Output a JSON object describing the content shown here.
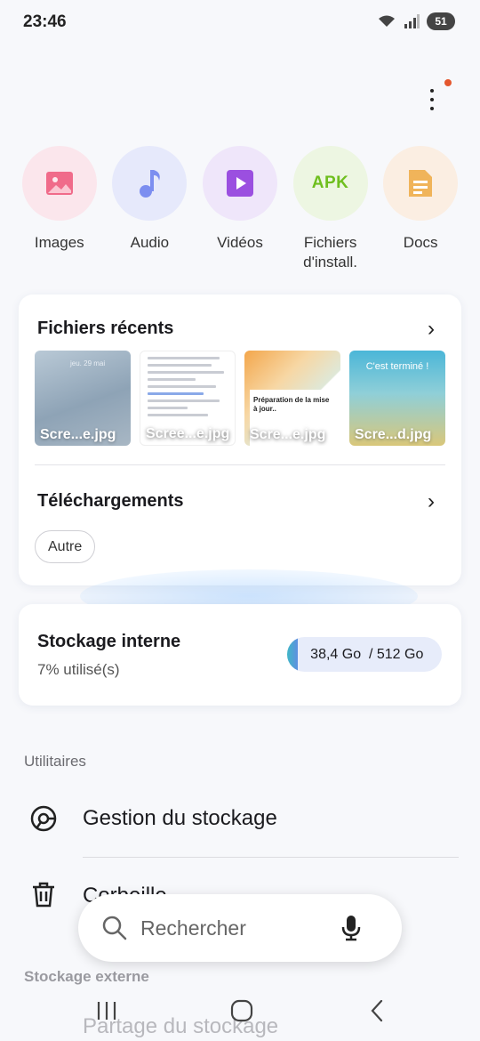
{
  "status_bar": {
    "time": "23:46",
    "battery": "51"
  },
  "categories": [
    {
      "label": "Images",
      "icon": "image-icon",
      "bg": "#fbe6ec"
    },
    {
      "label": "Audio",
      "icon": "music-note-icon",
      "bg": "#e6e9fb"
    },
    {
      "label": "Vidéos",
      "icon": "video-icon",
      "bg": "#efe6fa"
    },
    {
      "label": "Fichiers\nd'install.",
      "icon": "apk-icon",
      "icon_text": "APK",
      "bg": "#edf6e2"
    },
    {
      "label": "Docs",
      "icon": "document-icon",
      "bg": "#fbeee2"
    }
  ],
  "recent": {
    "title": "Fichiers récents",
    "thumbs": [
      {
        "name": "Scre...e.jpg",
        "overlay": "jeu. 29 mai"
      },
      {
        "name": "Scree...e.jpg"
      },
      {
        "name": "Scre...e.jpg",
        "overlay": "Préparation de la mise à jour.."
      },
      {
        "name": "Scre...d.jpg",
        "overlay": "C'est terminé !"
      }
    ]
  },
  "downloads": {
    "title": "Téléchargements",
    "chip": "Autre"
  },
  "storage": {
    "title": "Stockage interne",
    "used_pct": "7% utilisé(s)",
    "used_fraction": 0.07,
    "usage": "38,4 Go  / 512 Go"
  },
  "utilities": {
    "title": "Utilitaires",
    "items": [
      {
        "label": "Gestion du stockage",
        "icon": "storage-chart-icon"
      },
      {
        "label": "Corbeille",
        "icon": "trash-icon"
      }
    ]
  },
  "external": {
    "title": "Stockage externe",
    "item": "Partage du stockage"
  },
  "search": {
    "placeholder": "Rechercher"
  },
  "colors": {
    "accent": "#6fbf1f",
    "notif": "#e4572e"
  }
}
